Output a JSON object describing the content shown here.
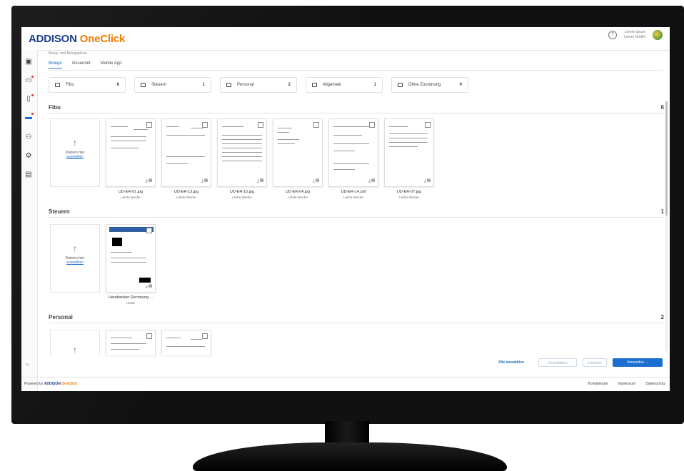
{
  "app": {
    "logo_part1": "ADDISON",
    "logo_part2": "OneClick"
  },
  "header": {
    "help_glyph": "?",
    "user_line1": "Lorem Ipsum",
    "user_line2": "Lorem GmbH"
  },
  "breadcrumb": "Beleg- und Belegupload",
  "tabs": [
    {
      "label": "Belege",
      "active": true
    },
    {
      "label": "Gesendet",
      "active": false
    },
    {
      "label": "Mobile App",
      "active": false
    }
  ],
  "categories": [
    {
      "label": "Fibu",
      "count": "6"
    },
    {
      "label": "Steuern",
      "count": "1"
    },
    {
      "label": "Personal",
      "count": "2"
    },
    {
      "label": "Allgemein",
      "count": "1"
    },
    {
      "label": "Ohne Zuordnung",
      "count": "0"
    }
  ],
  "sections": {
    "fibu": {
      "title": "Fibu",
      "count": "6"
    },
    "steuern": {
      "title": "Steuern",
      "count": "1"
    },
    "personal": {
      "title": "Personal",
      "count": "2"
    }
  },
  "upload": {
    "text": "Dateien hier",
    "link": "auswählen",
    "arrow": "↑"
  },
  "fibu_files": [
    {
      "name": "UD-ER-01.jpg",
      "sub": "Letzte Woche"
    },
    {
      "name": "UD-ER-13.jpg",
      "sub": "Letzte Woche"
    },
    {
      "name": "UD-ER-15.jpg",
      "sub": "Letzte Woche"
    },
    {
      "name": "UD-ER-04.jpg",
      "sub": "Letzte Woche"
    },
    {
      "name": "UD-ER-14.pdf",
      "sub": "Letzte Woche"
    },
    {
      "name": "UD-ER-07.jpg",
      "sub": "Letzte Woche"
    }
  ],
  "steuern_files": [
    {
      "name": "Handwerker Rechnung ...",
      "sub": "Heute"
    }
  ],
  "actions": {
    "select_all": "Alle auswählen",
    "move": "Verschieben",
    "delete": "Löschen",
    "send": "Versenden →"
  },
  "footer": {
    "powered_by": "Powered by",
    "brand1": "ADDISON",
    "brand2": "OneClick",
    "links": [
      "Kontaktkarte",
      "Impressum",
      "Datenschutz"
    ]
  },
  "icons": {
    "sidebar": [
      "image-icon",
      "inbox-icon",
      "document-upload-icon",
      "folder-icon",
      "users-icon",
      "settings-icon",
      "archive-icon"
    ],
    "actions": [
      "download-icon",
      "trash-icon"
    ]
  }
}
